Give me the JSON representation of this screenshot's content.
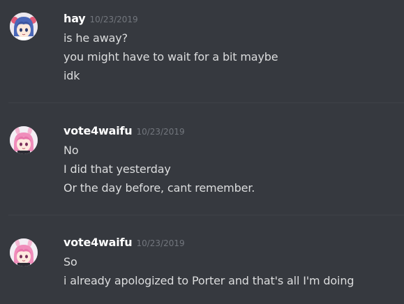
{
  "messages": [
    {
      "username": "hay",
      "timestamp": "10/23/2019",
      "avatar": "blue-haired-girl-avatar",
      "lines": [
        "is he away?",
        "you might have to wait for a bit maybe",
        "idk"
      ]
    },
    {
      "username": "vote4waifu",
      "timestamp": "10/23/2019",
      "avatar": "pink-bunny-girl-avatar",
      "lines": [
        "No",
        "I did that yesterday",
        "Or the day before, cant remember."
      ]
    },
    {
      "username": "vote4waifu",
      "timestamp": "10/23/2019",
      "avatar": "pink-bunny-girl-avatar",
      "lines": [
        "So",
        "i already apologized to Porter and that's all I'm doing"
      ]
    }
  ],
  "colors": {
    "background": "#36393f",
    "username": "#ffffff",
    "message_text": "#dcddde",
    "timestamp": "#72767d",
    "divider": "#3f4248"
  }
}
